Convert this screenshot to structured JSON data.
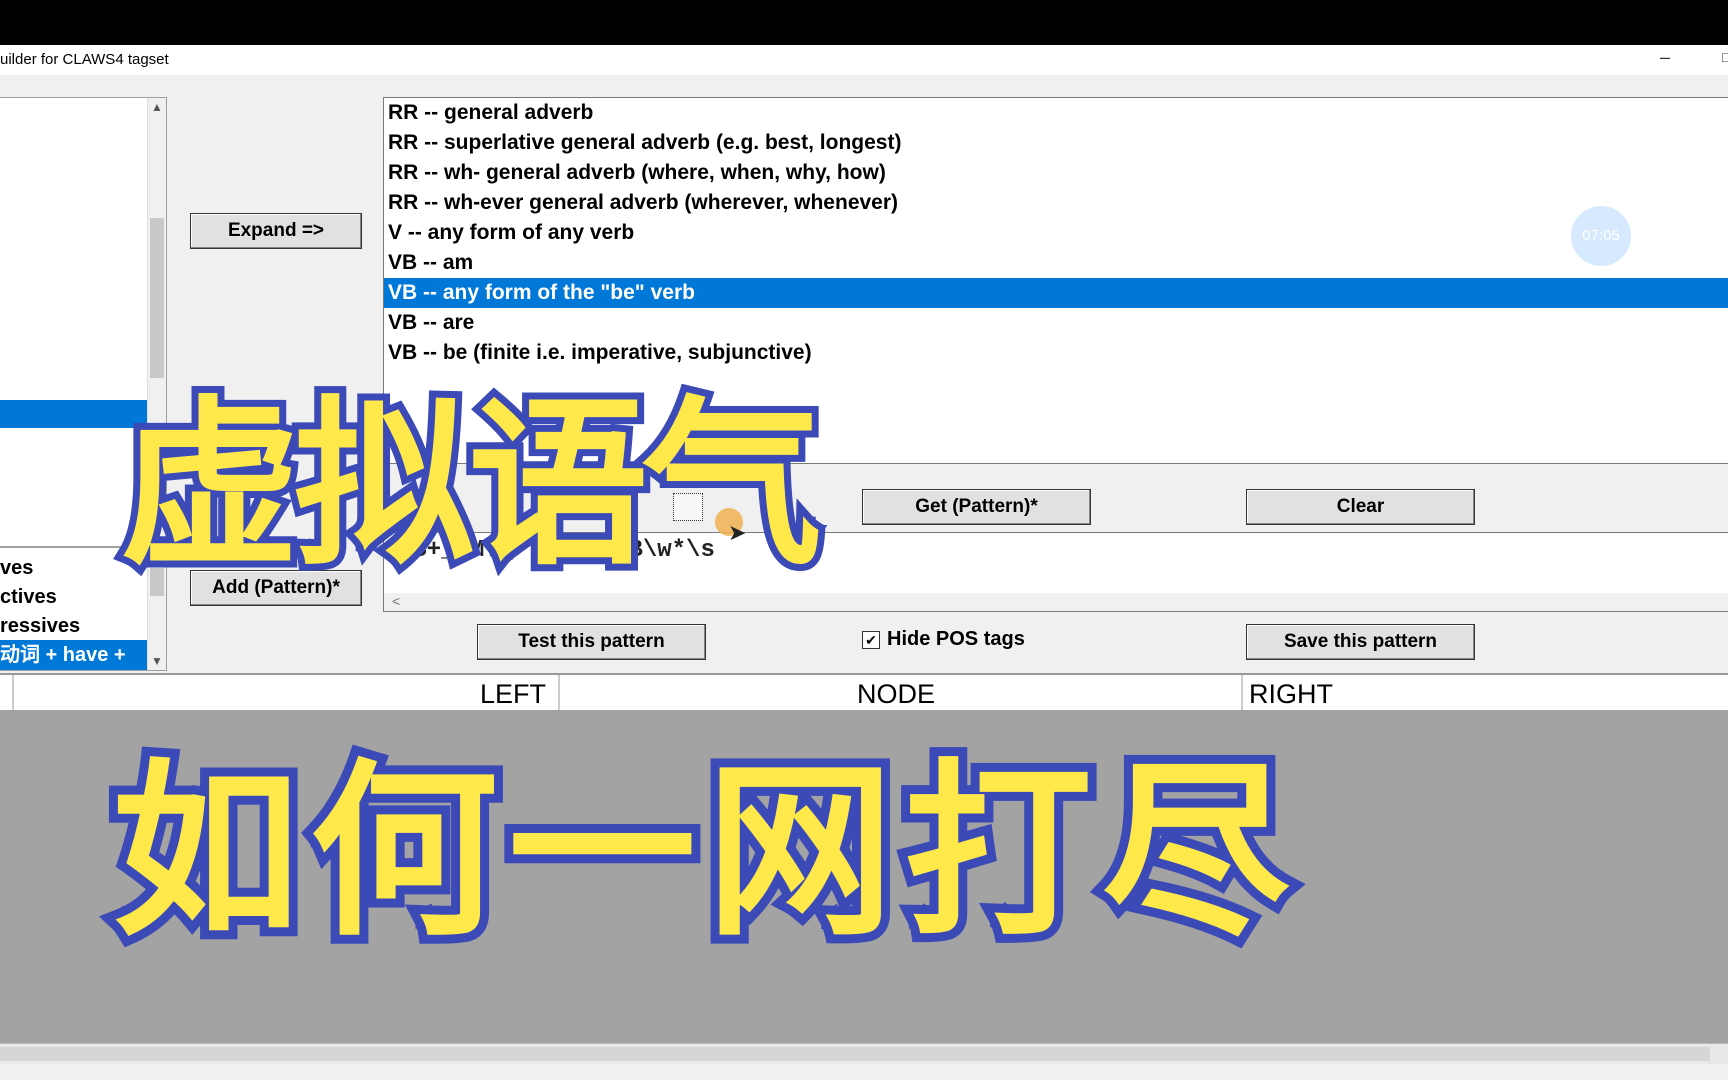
{
  "window": {
    "title": "uilder for CLAWS4 tagset",
    "minimize": "–",
    "maximize": "□"
  },
  "left_list": {
    "items": [
      {
        "label": "ves",
        "selected": false
      },
      {
        "label": "ctives",
        "selected": false
      },
      {
        "label": "ressives",
        "selected": false
      },
      {
        "label": "动词 + have +",
        "selected": true
      }
    ]
  },
  "buttons": {
    "expand": "Expand =>",
    "add_pattern": "Add (Pattern)*",
    "get_pattern": "Get (Pattern)*",
    "clear": "Clear",
    "test_pattern": "Test this pattern",
    "save_pattern": "Save this pattern"
  },
  "tag_list": {
    "items": [
      {
        "label": "RR -- general adverb",
        "selected": false
      },
      {
        "label": "RR -- superlative general adverb (e.g. best, longest)",
        "selected": false
      },
      {
        "label": "RR -- wh- general adverb (where, when, why, how)",
        "selected": false
      },
      {
        "label": "RR -- wh-ever general adverb (wherever, whenever)",
        "selected": false
      },
      {
        "label": "V -- any form of any verb",
        "selected": false
      },
      {
        "label": "VB -- am",
        "selected": false
      },
      {
        "label": "VB -- any form of the \"be\" verb",
        "selected": true
      },
      {
        "label": "VB -- are",
        "selected": false
      },
      {
        "label": "VB -- be (finite i.e. imperative, subjunctive)",
        "selected": false
      }
    ]
  },
  "pattern_text": "\\S+_VM\\w*\\s\\S+_VB\\w*\\s",
  "hide_pos_tags": {
    "label": "Hide POS tags",
    "checked": "✔"
  },
  "results_header": {
    "left": "LEFT",
    "node": "NODE",
    "right": "RIGHT"
  },
  "timer": "07:05",
  "overlay": {
    "title": "虚拟语气",
    "subtitle": "如何一网打尽"
  },
  "icons": {
    "scroll_up": "scroll-up-icon",
    "scroll_down": "scroll-down-icon",
    "cursor": "mouse-cursor-icon"
  }
}
